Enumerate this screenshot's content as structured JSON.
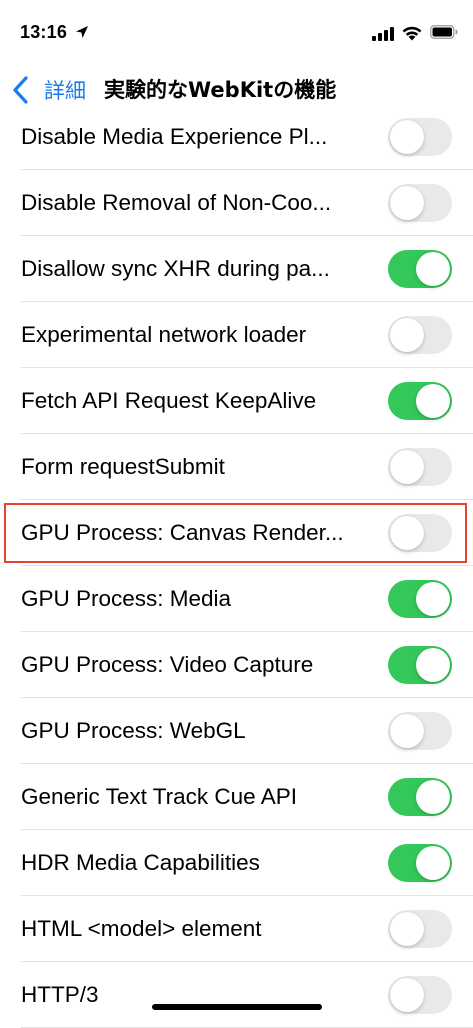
{
  "status_bar": {
    "time": "13:16",
    "icons": [
      "location-arrow-icon",
      "cellular-signal-icon",
      "wifi-icon",
      "battery-icon"
    ]
  },
  "nav": {
    "back_label": "詳細",
    "title": "実験的なWebKitの機能"
  },
  "colors": {
    "accent": "#1a7bf0",
    "toggle_on": "#34c759",
    "toggle_off": "#e9e9eb",
    "highlight": "#e5432d"
  },
  "rows": [
    {
      "label": "Disable Media Experience Pl...",
      "on": false
    },
    {
      "label": "Disable Removal of Non-Coo...",
      "on": false
    },
    {
      "label": "Disallow sync XHR during pa...",
      "on": true
    },
    {
      "label": "Experimental network loader",
      "on": false
    },
    {
      "label": "Fetch API Request KeepAlive",
      "on": true
    },
    {
      "label": "Form requestSubmit",
      "on": false
    },
    {
      "label": "GPU Process: Canvas Render...",
      "on": false,
      "highlighted": true
    },
    {
      "label": "GPU Process: Media",
      "on": true
    },
    {
      "label": "GPU Process: Video Capture",
      "on": true
    },
    {
      "label": "GPU Process: WebGL",
      "on": false
    },
    {
      "label": "Generic Text Track Cue API",
      "on": true
    },
    {
      "label": "HDR Media Capabilities",
      "on": true
    },
    {
      "label": "HTML <model> element",
      "on": false
    },
    {
      "label": "HTTP/3",
      "on": false
    }
  ]
}
